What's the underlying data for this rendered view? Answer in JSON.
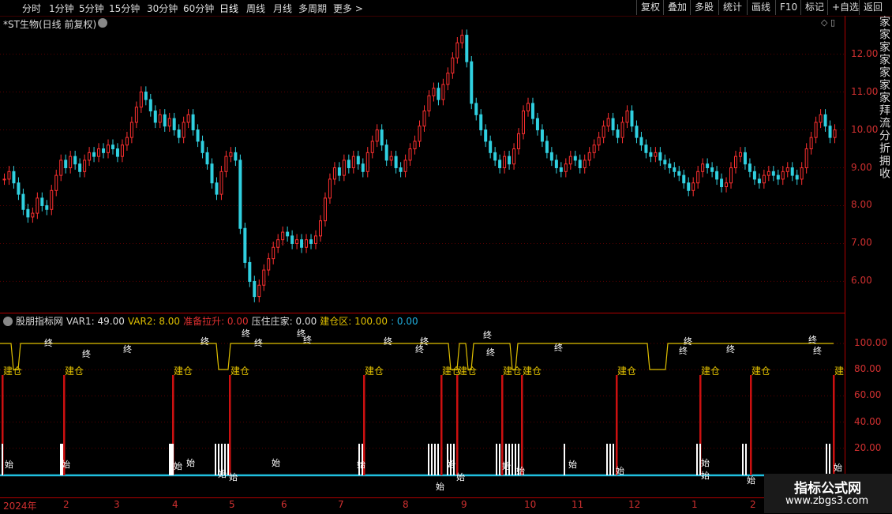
{
  "toolbar": {
    "periods": [
      "分时",
      "1分钟",
      "5分钟",
      "15分钟",
      "30分钟",
      "60分钟",
      "日线",
      "周线",
      "月线",
      "多周期",
      "更多 >"
    ],
    "active": "日线",
    "buttons": [
      "复权",
      "叠加",
      "多股",
      "统计",
      "画线",
      "F10",
      "标记",
      "+自选",
      "返回"
    ]
  },
  "main": {
    "title": "*ST生物(日线 前复权)",
    "price_axis": [
      "12.00",
      "11.00",
      "10.00",
      "9.00",
      "8.00",
      "7.00",
      "6.00"
    ]
  },
  "indicator": {
    "name": "股朋指标网",
    "items": [
      {
        "text": "VAR1: 49.00",
        "color": "#dddddd"
      },
      {
        "text": "VAR2: 8.00",
        "color": "#e0c000"
      },
      {
        "text": "准备拉升: 0.00",
        "color": "#e03030"
      },
      {
        "text": "压住庄家: 0.00",
        "color": "#dddddd"
      },
      {
        "text": "建仓区: 100.00",
        "color": "#e0c000"
      },
      {
        "text": ": 0.00",
        "color": "#20b0e0"
      }
    ],
    "value_axis": [
      "100.00",
      "80.00",
      "60.00",
      "40.00",
      "20.00"
    ],
    "label_build": "建仓",
    "label_end": "终",
    "label_start": "始"
  },
  "bottom_axis": [
    "2024年",
    "2",
    "3",
    "4",
    "5",
    "6",
    "7",
    "8",
    "9",
    "10",
    "11",
    "12",
    "1",
    "2"
  ],
  "right_side_text": "家家家家家家家拜流分折拥收",
  "watermark": {
    "title": "指标公式网",
    "url": "www.zbgs3.com"
  },
  "colors": {
    "up": "#ff3030",
    "down": "#30d0e0",
    "line": "#e0c000",
    "baseline": "#20c0e0",
    "bar": "#cc1010"
  },
  "chart_data": {
    "type": "candlestick",
    "ylim": [
      5.3,
      12.7
    ],
    "build_positions": [
      2,
      80,
      218,
      290,
      460,
      558,
      578,
      635,
      660,
      780,
      886,
      950,
      1055
    ],
    "closes": [
      8.7,
      8.9,
      8.6,
      8.3,
      7.9,
      7.7,
      7.8,
      8.2,
      8.0,
      7.9,
      8.4,
      8.8,
      9.2,
      9.0,
      9.3,
      9.1,
      8.9,
      9.2,
      9.4,
      9.3,
      9.5,
      9.4,
      9.6,
      9.5,
      9.3,
      9.6,
      9.8,
      10.2,
      10.6,
      11.0,
      10.8,
      10.5,
      10.2,
      10.4,
      10.1,
      10.3,
      10.0,
      9.8,
      10.2,
      10.4,
      10.0,
      9.7,
      9.4,
      9.1,
      8.6,
      8.3,
      8.9,
      9.3,
      9.4,
      9.2,
      7.4,
      6.5,
      6.0,
      5.6,
      5.9,
      6.3,
      6.6,
      6.9,
      7.1,
      7.3,
      7.2,
      7.0,
      7.1,
      6.9,
      7.1,
      7.0,
      7.2,
      7.6,
      8.2,
      8.7,
      9.0,
      8.8,
      9.2,
      9.0,
      9.3,
      9.1,
      8.9,
      9.4,
      9.7,
      10.0,
      9.6,
      9.2,
      9.3,
      9.0,
      8.9,
      9.2,
      9.5,
      9.7,
      10.1,
      10.5,
      10.9,
      11.1,
      10.8,
      11.2,
      11.5,
      11.9,
      12.3,
      12.5,
      11.8,
      10.7,
      10.4,
      10.0,
      9.7,
      9.4,
      9.2,
      9.0,
      9.3,
      9.1,
      9.5,
      9.9,
      10.5,
      10.7,
      10.3,
      10.0,
      9.7,
      9.4,
      9.2,
      9.0,
      8.9,
      9.1,
      9.3,
      9.2,
      9.0,
      9.2,
      9.4,
      9.6,
      9.8,
      10.1,
      10.3,
      10.0,
      9.8,
      10.2,
      10.5,
      10.1,
      9.8,
      9.6,
      9.4,
      9.3,
      9.4,
      9.2,
      9.1,
      9.0,
      8.9,
      8.8,
      8.6,
      8.4,
      8.6,
      8.9,
      9.1,
      9.0,
      8.9,
      8.7,
      8.5,
      8.6,
      9.0,
      9.3,
      9.4,
      9.1,
      8.9,
      8.7,
      8.6,
      8.8,
      8.9,
      8.8,
      8.7,
      8.9,
      9.0,
      8.8,
      8.7,
      9.0,
      9.5,
      9.8,
      10.2,
      10.4,
      10.1,
      9.8,
      10.0
    ]
  }
}
